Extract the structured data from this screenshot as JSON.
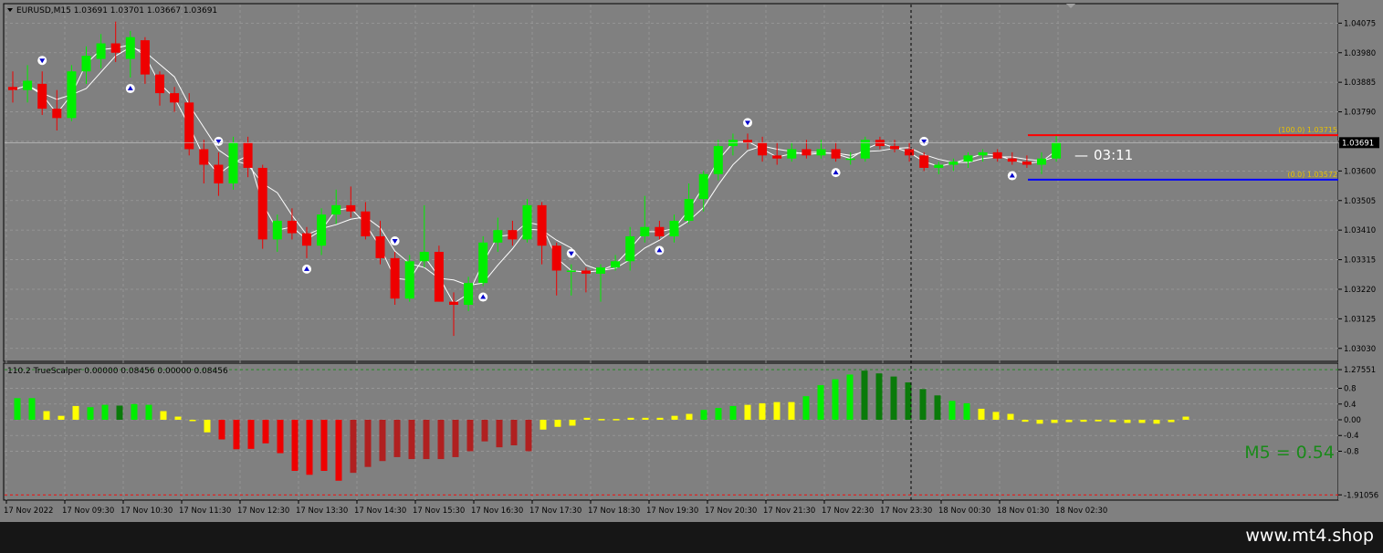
{
  "header": {
    "symbol_line": "EURUSD,M15  1.03691 1.03701 1.03667 1.03691",
    "indicator_line": "110.2 TrueScalper 0.00000 0.08456 0.00000 0.08456"
  },
  "price_tag": "1.03691",
  "timer": "03:11",
  "timer_prefix": "—",
  "m5_label": "M5 = 0.54",
  "footer_url": "www.mt4.shop",
  "fib": {
    "high_label": "(100.0)  1.03715",
    "low_label": "(0.0)  1.03572"
  },
  "colors": {
    "background": "#808080",
    "bull": "#00ee00",
    "bear": "#ee0000",
    "dark_green": "#0a7a0a",
    "dark_red": "#b02020",
    "yellow": "#ffff00",
    "arrow": "#0000cc",
    "fib_high": "#ff0000",
    "fib_low": "#0000ff"
  },
  "chart_data": [
    {
      "type": "candlestick",
      "symbol": "EURUSD",
      "timeframe": "M15",
      "ylim": [
        1.03,
        1.0412
      ],
      "price_ticks": [
        "1.04075",
        "1.03980",
        "1.03885",
        "1.03790",
        "1.03695",
        "1.03600",
        "1.03505",
        "1.03410",
        "1.03315",
        "1.03220",
        "1.03125",
        "1.03030"
      ],
      "current_price": 1.03691,
      "fib_levels": [
        {
          "level": "100.0",
          "price": 1.03715
        },
        {
          "level": "0.0",
          "price": 1.03572
        }
      ],
      "time_labels": [
        "17 Nov 2022",
        "17 Nov 09:30",
        "17 Nov 10:30",
        "17 Nov 11:30",
        "17 Nov 12:30",
        "17 Nov 13:30",
        "17 Nov 14:30",
        "17 Nov 15:30",
        "17 Nov 16:30",
        "17 Nov 17:30",
        "17 Nov 18:30",
        "17 Nov 19:30",
        "17 Nov 20:30",
        "17 Nov 21:30",
        "17 Nov 22:30",
        "17 Nov 23:30",
        "18 Nov 00:30",
        "18 Nov 01:30",
        "18 Nov 02:30"
      ],
      "candles": [
        [
          1.0387,
          1.0392,
          1.0382,
          1.0386
        ],
        [
          1.0386,
          1.0394,
          1.0382,
          1.0389
        ],
        [
          1.0388,
          1.0392,
          1.0378,
          1.038
        ],
        [
          1.038,
          1.0386,
          1.0373,
          1.0377
        ],
        [
          1.0377,
          1.0394,
          1.0376,
          1.0392
        ],
        [
          1.0392,
          1.04,
          1.0388,
          1.0397
        ],
        [
          1.0396,
          1.0404,
          1.0393,
          1.0401
        ],
        [
          1.0401,
          1.0408,
          1.0395,
          1.0398
        ],
        [
          1.0396,
          1.0405,
          1.039,
          1.0403
        ],
        [
          1.0402,
          1.0403,
          1.0388,
          1.0391
        ],
        [
          1.0391,
          1.0392,
          1.0381,
          1.0385
        ],
        [
          1.0385,
          1.0387,
          1.0379,
          1.0382
        ],
        [
          1.0382,
          1.0385,
          1.0365,
          1.0367
        ],
        [
          1.0367,
          1.037,
          1.0356,
          1.0362
        ],
        [
          1.0362,
          1.0366,
          1.0352,
          1.0356
        ],
        [
          1.0356,
          1.0371,
          1.0354,
          1.0369
        ],
        [
          1.0369,
          1.0371,
          1.0358,
          1.0361
        ],
        [
          1.0361,
          1.0362,
          1.0335,
          1.0338
        ],
        [
          1.0338,
          1.0346,
          1.0334,
          1.0344
        ],
        [
          1.0344,
          1.0348,
          1.0338,
          1.034
        ],
        [
          1.034,
          1.0342,
          1.0332,
          1.0336
        ],
        [
          1.0336,
          1.0348,
          1.0333,
          1.0346
        ],
        [
          1.0346,
          1.0354,
          1.0343,
          1.0349
        ],
        [
          1.0349,
          1.0355,
          1.0345,
          1.0347
        ],
        [
          1.0347,
          1.035,
          1.0338,
          1.0339
        ],
        [
          1.0339,
          1.0344,
          1.033,
          1.0332
        ],
        [
          1.0332,
          1.0334,
          1.0317,
          1.0319
        ],
        [
          1.0319,
          1.0333,
          1.0318,
          1.0331
        ],
        [
          1.0331,
          1.0349,
          1.0329,
          1.0334
        ],
        [
          1.0334,
          1.0336,
          1.0318,
          1.0318
        ],
        [
          1.0318,
          1.0321,
          1.0307,
          1.0317
        ],
        [
          1.0317,
          1.0326,
          1.0315,
          1.0324
        ],
        [
          1.0324,
          1.0339,
          1.0323,
          1.0337
        ],
        [
          1.0337,
          1.0345,
          1.0334,
          1.0341
        ],
        [
          1.0341,
          1.0344,
          1.0336,
          1.0338
        ],
        [
          1.0338,
          1.0351,
          1.0337,
          1.0349
        ],
        [
          1.0349,
          1.035,
          1.033,
          1.0336
        ],
        [
          1.0336,
          1.0337,
          1.032,
          1.0328
        ],
        [
          1.0328,
          1.033,
          1.032,
          1.0328
        ],
        [
          1.0328,
          1.0329,
          1.0321,
          1.0327
        ],
        [
          1.0327,
          1.033,
          1.0318,
          1.0329
        ],
        [
          1.0329,
          1.0333,
          1.0328,
          1.0331
        ],
        [
          1.0331,
          1.0342,
          1.0328,
          1.0339
        ],
        [
          1.0339,
          1.0352,
          1.0337,
          1.0342
        ],
        [
          1.0342,
          1.0344,
          1.0338,
          1.0339
        ],
        [
          1.0339,
          1.0346,
          1.0337,
          1.0344
        ],
        [
          1.0344,
          1.0356,
          1.0343,
          1.0351
        ],
        [
          1.0351,
          1.036,
          1.0347,
          1.0359
        ],
        [
          1.0359,
          1.037,
          1.0357,
          1.0368
        ],
        [
          1.0368,
          1.0372,
          1.0365,
          1.037
        ],
        [
          1.037,
          1.0372,
          1.0367,
          1.0369
        ],
        [
          1.0369,
          1.0371,
          1.0363,
          1.0365
        ],
        [
          1.0365,
          1.0369,
          1.0362,
          1.0364
        ],
        [
          1.0364,
          1.0369,
          1.0363,
          1.0367
        ],
        [
          1.0367,
          1.037,
          1.0364,
          1.0365
        ],
        [
          1.0365,
          1.037,
          1.0364,
          1.0367
        ],
        [
          1.0367,
          1.0369,
          1.0363,
          1.0364
        ],
        [
          1.0364,
          1.0366,
          1.0362,
          1.0364
        ],
        [
          1.0364,
          1.0371,
          1.0363,
          1.037
        ],
        [
          1.037,
          1.0371,
          1.0367,
          1.0368
        ],
        [
          1.0368,
          1.037,
          1.0366,
          1.0367
        ],
        [
          1.0367,
          1.0369,
          1.0363,
          1.0365
        ],
        [
          1.0365,
          1.0366,
          1.036,
          1.0361
        ],
        [
          1.0361,
          1.0363,
          1.0359,
          1.0362
        ],
        [
          1.0362,
          1.0364,
          1.036,
          1.0363
        ],
        [
          1.0363,
          1.0366,
          1.0361,
          1.0365
        ],
        [
          1.0365,
          1.0367,
          1.0363,
          1.0366
        ],
        [
          1.0366,
          1.0367,
          1.0363,
          1.0364
        ],
        [
          1.0364,
          1.0366,
          1.0362,
          1.0363
        ],
        [
          1.0363,
          1.0365,
          1.0361,
          1.0362
        ],
        [
          1.0362,
          1.0366,
          1.0359,
          1.0364
        ],
        [
          1.0364,
          1.03715,
          1.0363,
          1.03691
        ]
      ]
    },
    {
      "type": "bar",
      "name": "TrueScalper",
      "ylim": [
        -1.95,
        1.3
      ],
      "y_ticks": [
        "1.27551",
        "0.8",
        "0.4",
        "0.00",
        "-0.4",
        "-0.8",
        "-1.91056"
      ],
      "values": [
        0.55,
        0.55,
        0.22,
        0.1,
        0.35,
        0.32,
        0.38,
        0.36,
        0.4,
        0.38,
        0.22,
        0.08,
        -0.02,
        -0.32,
        -0.5,
        -0.75,
        -0.74,
        -0.6,
        -0.85,
        -1.3,
        -1.4,
        -1.3,
        -1.55,
        -1.35,
        -1.2,
        -1.05,
        -0.95,
        -1.0,
        -1.0,
        -1.0,
        -0.95,
        -0.8,
        -0.55,
        -0.7,
        -0.65,
        -0.8,
        -0.25,
        -0.18,
        -0.15,
        0.05,
        0.02,
        0.02,
        0.05,
        0.05,
        0.05,
        0.1,
        0.15,
        0.25,
        0.3,
        0.35,
        0.38,
        0.42,
        0.45,
        0.45,
        0.6,
        0.88,
        1.03,
        1.15,
        1.25,
        1.18,
        1.1,
        0.95,
        0.78,
        0.62,
        0.48,
        0.42,
        0.28,
        0.2,
        0.15,
        -0.05,
        -0.1,
        -0.08,
        -0.06,
        -0.05,
        -0.04,
        -0.06,
        -0.08,
        -0.08,
        -0.1,
        -0.06,
        0.08
      ],
      "bar_colors": [
        "bull",
        "bull",
        "yellow",
        "yellow",
        "yellow",
        "bull",
        "bull",
        "dark_green",
        "bull",
        "bull",
        "yellow",
        "yellow",
        "yellow",
        "yellow",
        "bear",
        "bear",
        "bear",
        "bear",
        "bear",
        "bear",
        "bear",
        "bear",
        "bear",
        "dark_red",
        "dark_red",
        "dark_red",
        "dark_red",
        "dark_red",
        "dark_red",
        "dark_red",
        "dark_red",
        "dark_red",
        "dark_red",
        "dark_red",
        "dark_red",
        "dark_red",
        "yellow",
        "yellow",
        "yellow",
        "yellow",
        "yellow",
        "yellow",
        "yellow",
        "yellow",
        "yellow",
        "yellow",
        "yellow",
        "bull",
        "bull",
        "bull",
        "yellow",
        "yellow",
        "yellow",
        "yellow",
        "bull",
        "bull",
        "bull",
        "bull",
        "dark_green",
        "dark_green",
        "dark_green",
        "dark_green",
        "dark_green",
        "dark_green",
        "bull",
        "bull",
        "yellow",
        "yellow",
        "yellow",
        "yellow",
        "yellow",
        "yellow",
        "yellow",
        "yellow",
        "yellow",
        "yellow",
        "yellow",
        "yellow",
        "yellow",
        "yellow",
        "yellow"
      ]
    }
  ]
}
